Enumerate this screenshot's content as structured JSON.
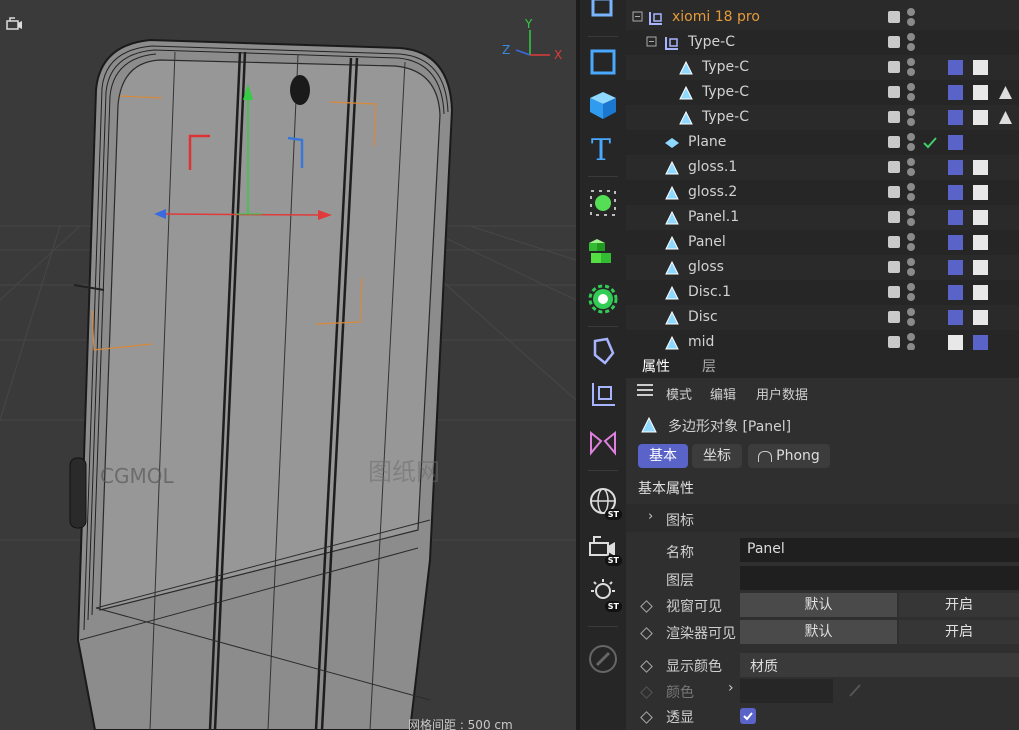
{
  "viewport": {
    "camera_icon": "camera-icon",
    "axis_labels": {
      "y": "Y",
      "z": "Z",
      "x": "X"
    },
    "watermark_left": "CGMOL",
    "watermark_right": "图纸网",
    "grid_spacing_label": "网格间距 : 500 cm"
  },
  "toolbar": {
    "tools": [
      {
        "name": "loft-tool",
        "icon": "loft-icon"
      },
      {
        "name": "cube-tool",
        "icon": "square-icon"
      },
      {
        "name": "cube3d-tool",
        "icon": "cube-icon"
      },
      {
        "name": "text-tool",
        "icon": "text-icon"
      },
      {
        "name": "subdivision-tool",
        "icon": "subdivision-icon"
      },
      {
        "name": "cloner-tool",
        "icon": "cloner-icon"
      },
      {
        "name": "gear-tool",
        "icon": "gear-icon"
      },
      {
        "name": "deformer-tool",
        "icon": "deformer-icon"
      },
      {
        "name": "null-tool",
        "icon": "null-icon"
      },
      {
        "name": "symmetry-tool",
        "icon": "symmetry-icon"
      },
      {
        "name": "globe-tool",
        "icon": "globe-icon",
        "badge": "ST"
      },
      {
        "name": "camera-tool",
        "icon": "camera-icon",
        "badge": "ST"
      },
      {
        "name": "light-tool",
        "icon": "light-icon",
        "badge": "ST"
      },
      {
        "name": "paint-tool",
        "icon": "paint-icon"
      }
    ]
  },
  "objects": [
    {
      "label": "xiomi 18 pro",
      "icon": "null-icon",
      "highlight": true
    },
    {
      "label": "Type-C",
      "icon": "null-icon"
    },
    {
      "label": "Type-C",
      "icon": "polygon-icon"
    },
    {
      "label": "Type-C",
      "icon": "polygon-icon"
    },
    {
      "label": "Type-C",
      "icon": "polygon-icon"
    },
    {
      "label": "Plane",
      "icon": "plane-icon"
    },
    {
      "label": "gloss.1",
      "icon": "polygon-icon"
    },
    {
      "label": "gloss.2",
      "icon": "polygon-icon"
    },
    {
      "label": "Panel.1",
      "icon": "polygon-icon"
    },
    {
      "label": "Panel",
      "icon": "polygon-icon"
    },
    {
      "label": "gloss",
      "icon": "polygon-icon"
    },
    {
      "label": "Disc.1",
      "icon": "polygon-icon"
    },
    {
      "label": "Disc",
      "icon": "polygon-icon"
    },
    {
      "label": "mid",
      "icon": "polygon-icon"
    }
  ],
  "attributes": {
    "tabs": [
      "属性",
      "层"
    ],
    "menu": [
      "模式",
      "编辑",
      "用户数据"
    ],
    "object_title": "多边形对象 [Panel]",
    "pills": [
      "基本",
      "坐标",
      "Phong"
    ],
    "section_title": "基本属性",
    "icon_group": "图标",
    "name_label": "名称",
    "name_value": "Panel",
    "layer_label": "图层",
    "viewport_visible_label": "视窗可见",
    "viewport_visible_default": "默认",
    "viewport_visible_on": "开启",
    "render_visible_label": "渲染器可见",
    "render_visible_default": "默认",
    "render_visible_on": "开启",
    "display_color_label": "显示颜色",
    "display_color_value": "材质",
    "color_label": "颜色",
    "xray_label": "透显",
    "xray_checked": true
  },
  "colors": {
    "accent": "#5a64c8",
    "highlight_text": "#e69b3a",
    "check": "#3fcf6a"
  }
}
